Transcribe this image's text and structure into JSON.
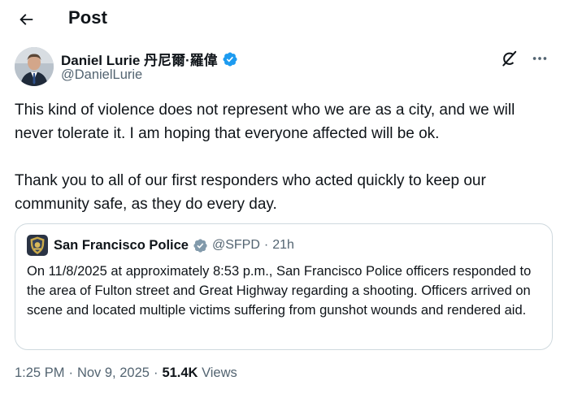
{
  "header": {
    "title": "Post"
  },
  "author": {
    "name": "Daniel Lurie 丹尼爾·羅偉",
    "handle": "@DanielLurie",
    "verified_color": "#1d9bf0"
  },
  "tweet": {
    "paragraphs": [
      "This kind of violence does not represent who we are as a city, and we will never tolerate it. I am hoping that everyone affected will be ok.",
      "Thank you to all of our first responders who acted quickly to keep our community safe, as they do every day."
    ]
  },
  "quote": {
    "name": "San Francisco Police",
    "handle": "@SFPD",
    "dot": "·",
    "time": "21h",
    "badge_color": "#829aab",
    "text": "On 11/8/2025 at approximately 8:53 p.m., San Francisco Police officers responded to the area of Fulton street and Great Highway regarding a shooting.  Officers arrived on scene and located multiple victims suffering from gunshot wounds and rendered aid."
  },
  "meta": {
    "time": "1:25 PM",
    "dot": "·",
    "date": "Nov 9, 2025",
    "views_count": "51.4K",
    "views_label": "Views"
  },
  "icons": {
    "back": "arrow-left-icon",
    "grok": "grok-icon",
    "more": "more-horizontal-icon",
    "verified": "verified-badge-icon",
    "gov_badge": "government-badge-icon"
  }
}
